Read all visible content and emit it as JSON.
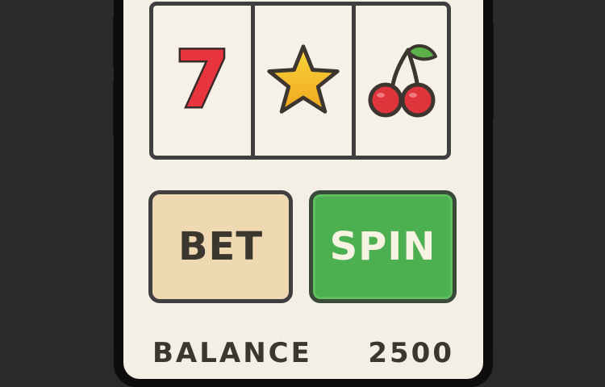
{
  "reels": [
    {
      "symbol": "seven-icon",
      "text": "7",
      "color": "#e8343d"
    },
    {
      "symbol": "star-icon",
      "color": "#f2b823"
    },
    {
      "symbol": "cherry-icon",
      "color": "#e0343c"
    }
  ],
  "controls": {
    "bet_label": "BET",
    "spin_label": "SPIN"
  },
  "footer": {
    "balance_label": "BALANCE",
    "balance_value": "2500"
  },
  "colors": {
    "bet_bg": "#efd9b3",
    "spin_bg": "#4caf50",
    "screen_bg": "#f4efe5"
  }
}
